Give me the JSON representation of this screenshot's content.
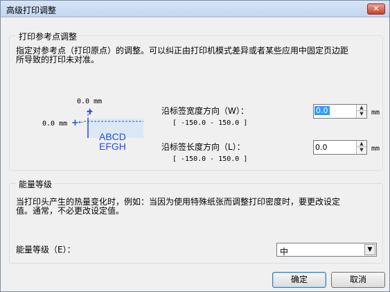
{
  "window": {
    "title": "高级打印调整",
    "close_label": "✕"
  },
  "reference_group": {
    "title": "打印参考点调整",
    "description_line1": "指定对参考点（打印原点）的调整。可以纠正由打印机模式差异或者某些应用中固定页边距",
    "description_line2": "所导致的打印未对准。",
    "diagram": {
      "top_value": "0.0 mm",
      "left_value": "0.0 mm",
      "label_line1": "ABCD",
      "label_line2": "EFGH"
    },
    "width_direction": {
      "label": "沿标签宽度方向（W）：",
      "range": "[ -150.0 - 150.0 ]",
      "value": "0.0",
      "unit": "mm"
    },
    "length_direction": {
      "label": "沿标签长度方向（L）：",
      "range": "[ -150.0 - 150.0 ]",
      "value": "0.0",
      "unit": "mm"
    }
  },
  "energy_group": {
    "title": "能量等级",
    "description_line1": "当打印头产生的热量变化时，例如：当因为使用特殊纸张而调整打印密度时，要更改设定",
    "description_line2": "值。通常，不必更改设定值。",
    "level_label": "能量等级（E）：",
    "level_value": "中"
  },
  "buttons": {
    "ok": "确定",
    "cancel": "取消"
  }
}
